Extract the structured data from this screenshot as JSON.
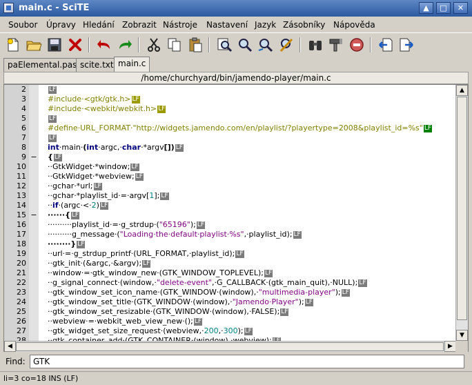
{
  "window": {
    "title": "main.c - SciTE",
    "buttons": [
      "▲",
      "□",
      "✕"
    ]
  },
  "menu": [
    "Soubor",
    "Úpravy",
    "Hledání",
    "Zobrazit",
    "Nástroje",
    "Nastavení",
    "Jazyk",
    "Zásobníky",
    "Nápověda"
  ],
  "toolbar": {
    "icons": [
      "new-file-icon",
      "open-folder-icon",
      "save-disk-icon",
      "close-x-icon",
      "undo-icon",
      "redo-icon",
      "cut-icon",
      "copy-icon",
      "paste-icon",
      "find-icon",
      "find-next-icon",
      "find-replace-icon",
      "find-in-files-icon",
      "binoculars-icon",
      "compile-icon",
      "stop-icon",
      "previous-file-icon",
      "next-file-icon"
    ]
  },
  "tabs": [
    {
      "label": "paElemental.pas",
      "active": false
    },
    {
      "label": "scite.txt",
      "active": false
    },
    {
      "label": "main.c",
      "active": true
    }
  ],
  "path": "/home/churchyard/bin/jamendo-player/main.c",
  "editor": {
    "line_numbers": [
      "2",
      "3",
      "4",
      "5",
      "6",
      "7",
      "8",
      "9",
      "10",
      "11",
      "12",
      "13",
      "14",
      "15",
      "16",
      "17",
      "18",
      "19",
      "20",
      "21",
      "22",
      "23",
      "24",
      "25",
      "26",
      "27",
      "28"
    ],
    "fold_markers": [
      "",
      "",
      "",
      "",
      "",
      "",
      "",
      "−",
      "",
      "",
      "",
      "",
      "",
      "−",
      "",
      "",
      "",
      "",
      "",
      "",
      "",
      "",
      "",
      "",
      "",
      "",
      ""
    ],
    "lines": [
      {
        "segs": [],
        "lf": "LF"
      },
      {
        "segs": [
          {
            "t": "#include·<gtk/gtk.h>",
            "c": "pp"
          }
        ],
        "lf": "LF",
        "lfc": "pplf"
      },
      {
        "segs": [
          {
            "t": "#include·<webkit/webkit.h>",
            "c": "pp"
          }
        ],
        "lf": "LF",
        "lfc": "pplf"
      },
      {
        "segs": [],
        "lf": "LF"
      },
      {
        "segs": [
          {
            "t": "#define·URL_FORMAT·\"http://widgets.jamendo.com/en/playlist/?playertype=2008&playlist_id=%s\"",
            "c": "pp"
          }
        ],
        "lf": "LF",
        "lfc": "deflf"
      },
      {
        "segs": [],
        "lf": "LF"
      },
      {
        "segs": [
          {
            "t": "int",
            "c": "kw"
          },
          {
            "t": "·main·",
            "c": ""
          },
          {
            "t": "(",
            "c": "op"
          },
          {
            "t": "int",
            "c": "kw"
          },
          {
            "t": "·argc,·",
            "c": ""
          },
          {
            "t": "char",
            "c": "kw"
          },
          {
            "t": "·*argv",
            "c": ""
          },
          {
            "t": "[])",
            "c": "op"
          }
        ],
        "lf": "LF"
      },
      {
        "segs": [
          {
            "t": "{",
            "c": "op"
          }
        ],
        "lf": "LF"
      },
      {
        "segs": [
          {
            "t": "··GtkWidget·*window;",
            "c": ""
          }
        ],
        "lf": "LF"
      },
      {
        "segs": [
          {
            "t": "··GtkWidget·*webview;",
            "c": ""
          }
        ],
        "lf": "LF"
      },
      {
        "segs": [
          {
            "t": "··gchar·*url;",
            "c": ""
          }
        ],
        "lf": "LF"
      },
      {
        "segs": [
          {
            "t": "··gchar·*playlist_id·=·argv[",
            "c": ""
          },
          {
            "t": "1",
            "c": "num"
          },
          {
            "t": "];",
            "c": ""
          }
        ],
        "lf": "LF"
      },
      {
        "segs": [
          {
            "t": "··",
            "c": ""
          },
          {
            "t": "if",
            "c": "kw"
          },
          {
            "t": "·(argc·<·",
            "c": ""
          },
          {
            "t": "2",
            "c": "num"
          },
          {
            "t": ")",
            "c": ""
          }
        ],
        "lf": "LF"
      },
      {
        "segs": [
          {
            "t": "······{",
            "c": "op"
          }
        ],
        "lf": "LF"
      },
      {
        "segs": [
          {
            "t": "··········playlist_id·=·g_strdup·(",
            "c": ""
          },
          {
            "t": "\"65196\"",
            "c": "str"
          },
          {
            "t": ");",
            "c": ""
          }
        ],
        "lf": "LF"
      },
      {
        "segs": [
          {
            "t": "··········g_message·(",
            "c": ""
          },
          {
            "t": "\"Loading·the·default·playlist·%s\"",
            "c": "str"
          },
          {
            "t": ",·playlist_id);",
            "c": ""
          }
        ],
        "lf": "LF"
      },
      {
        "segs": [
          {
            "t": "········}",
            "c": "op"
          }
        ],
        "lf": "LF"
      },
      {
        "segs": [
          {
            "t": "··url·=·g_strdup_printf·(URL_FORMAT,·playlist_id);",
            "c": ""
          }
        ],
        "lf": "LF"
      },
      {
        "segs": [
          {
            "t": "··gtk_init·(&argc,·&argv);",
            "c": ""
          }
        ],
        "lf": "LF"
      },
      {
        "segs": [
          {
            "t": "··window·=·gtk_window_new·(GTK_WINDOW_TOPLEVEL);",
            "c": ""
          }
        ],
        "lf": "LF"
      },
      {
        "segs": [
          {
            "t": "··g_signal_connect·(window,·",
            "c": ""
          },
          {
            "t": "\"delete-event\"",
            "c": "str"
          },
          {
            "t": ",·G_CALLBACK·(gtk_main_quit),·NULL);",
            "c": ""
          }
        ],
        "lf": "LF"
      },
      {
        "segs": [
          {
            "t": "··gtk_window_set_icon_name·(GTK_WINDOW·(window),·",
            "c": ""
          },
          {
            "t": "\"multimedia-player\"",
            "c": "str"
          },
          {
            "t": ");",
            "c": ""
          }
        ],
        "lf": "LF"
      },
      {
        "segs": [
          {
            "t": "··gtk_window_set_title·(GTK_WINDOW·(window),·",
            "c": ""
          },
          {
            "t": "\"Jamendo·Player\"",
            "c": "str"
          },
          {
            "t": ");",
            "c": ""
          }
        ],
        "lf": "LF"
      },
      {
        "segs": [
          {
            "t": "··gtk_window_set_resizable·(GTK_WINDOW·(window),·FALSE);",
            "c": ""
          }
        ],
        "lf": "LF"
      },
      {
        "segs": [
          {
            "t": "··webview·=·webkit_web_view_new·();",
            "c": ""
          }
        ],
        "lf": "LF"
      },
      {
        "segs": [
          {
            "t": "··gtk_widget_set_size_request·(webview,·",
            "c": ""
          },
          {
            "t": "200",
            "c": "num"
          },
          {
            "t": ",·",
            "c": ""
          },
          {
            "t": "300",
            "c": "num"
          },
          {
            "t": ");",
            "c": ""
          }
        ],
        "lf": "LF"
      },
      {
        "segs": [
          {
            "t": "··gtk_container_add·(GTK_CONTAINER·(window),·webview);",
            "c": ""
          }
        ],
        "lf": "LF"
      }
    ]
  },
  "find": {
    "label": "Find:",
    "value": "GTK"
  },
  "status": "li=3 co=18 INS (LF)"
}
